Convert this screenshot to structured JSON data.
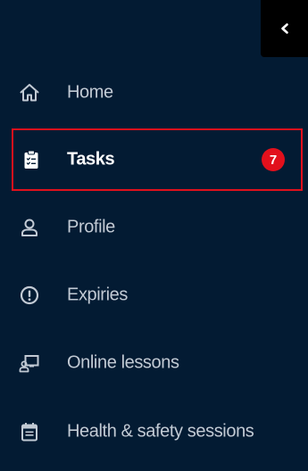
{
  "sidebar": {
    "collapse_icon": "chevron-left-icon",
    "items": [
      {
        "label": "Home",
        "icon": "home-icon"
      },
      {
        "label": "Tasks",
        "icon": "clipboard-icon",
        "badge": "7",
        "active": true
      },
      {
        "label": "Profile",
        "icon": "user-icon"
      },
      {
        "label": "Expiries",
        "icon": "alert-circle-icon"
      },
      {
        "label": "Online lessons",
        "icon": "online-lesson-icon"
      },
      {
        "label": "Health & safety sessions",
        "icon": "calendar-icon"
      }
    ]
  },
  "colors": {
    "background": "#031b33",
    "collapse_button": "#000000",
    "active_border": "#e0101c",
    "badge": "#e2101c",
    "label": "#c2cad4",
    "active_label": "#ffffff",
    "icon": "#c2cad4"
  }
}
